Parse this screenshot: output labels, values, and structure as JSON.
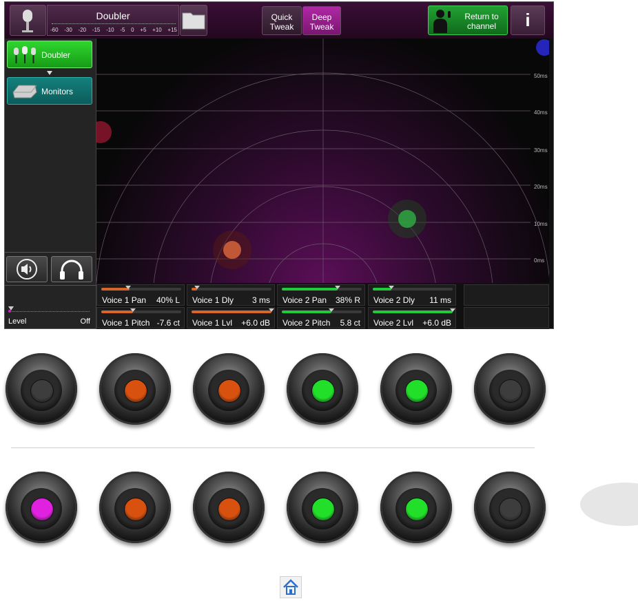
{
  "colors": {
    "accent_magenta": "#b028a4",
    "green": "#22c93a",
    "orange": "#d8662a",
    "teal": "#14807c",
    "led_off": "#3d3d3d"
  },
  "header": {
    "preset_name": "Doubler",
    "meter_ticks": [
      "-60",
      "-30",
      "-20",
      "-15",
      "-10",
      "-5",
      "0",
      "+5",
      "+10",
      "+15"
    ],
    "quick_tweak_line1": "Quick",
    "quick_tweak_line2": "Tweak",
    "deep_tweak_line1": "Deep",
    "deep_tweak_line2": "Tweak",
    "return_line1": "Return to",
    "return_line2": "channel",
    "info_label": "i"
  },
  "sidebar": {
    "blocks": [
      {
        "label": "Doubler",
        "icon": "microphones-icon"
      },
      {
        "label": "Monitors",
        "icon": "monitor-speaker-icon"
      }
    ],
    "level_label": "Level",
    "level_value": "Off"
  },
  "radar": {
    "delay_labels": [
      "50ms",
      "40ms",
      "30ms",
      "20ms",
      "10ms",
      "0ms"
    ]
  },
  "params": [
    {
      "name": "Voice 1 Pan",
      "value": "40% L",
      "fill": 0.35,
      "marker": 0.34,
      "color": "#d8662a"
    },
    {
      "name": "Voice 1 Dly",
      "value": "3 ms",
      "fill": 0.07,
      "marker": 0.07,
      "color": "#d8662a"
    },
    {
      "name": "Voice 2 Pan",
      "value": "38% R",
      "fill": 0.7,
      "marker": 0.7,
      "color": "#22c93a"
    },
    {
      "name": "Voice 2 Dly",
      "value": "11 ms",
      "fill": 0.23,
      "marker": 0.23,
      "color": "#22c93a"
    },
    {
      "name": "Voice 1 Pitch",
      "value": "-7.6 ct",
      "fill": 0.4,
      "marker": 0.4,
      "color": "#d8662a"
    },
    {
      "name": "Voice 1 Lvl",
      "value": "+6.0 dB",
      "fill": 1.0,
      "marker": 1.0,
      "color": "#d8662a"
    },
    {
      "name": "Voice 2 Pitch",
      "value": "5.8 ct",
      "fill": 0.62,
      "marker": 0.62,
      "color": "#22c93a"
    },
    {
      "name": "Voice 2 Lvl",
      "value": "+6.0 dB",
      "fill": 1.0,
      "marker": 1.0,
      "color": "#22c93a"
    }
  ],
  "knob_rows": [
    [
      "#3d3d3d",
      "#d8510f",
      "#d8510f",
      "#22e02a",
      "#22e02a",
      "#3d3d3d"
    ],
    [
      "#e021e0",
      "#d8510f",
      "#d8510f",
      "#22e02a",
      "#22e02a",
      "#3d3d3d"
    ]
  ]
}
